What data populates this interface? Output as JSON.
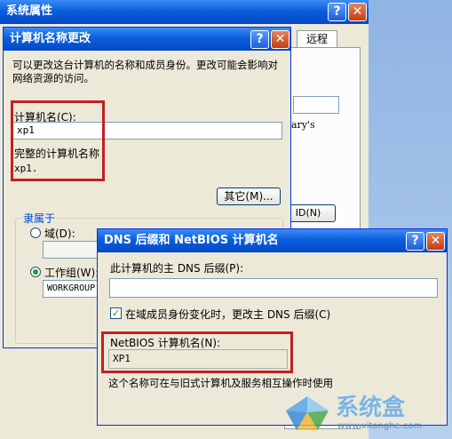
{
  "background_window": {
    "title": "系统属性",
    "tab_remote": "远程",
    "text_fragment": "ary's",
    "button_fragment": "ID(N)"
  },
  "rename_dialog": {
    "title": "计算机名称更改",
    "description": "可以更改这台计算机的名称和成员身份。更改可能会影响对网络资源的访问。",
    "computer_name_label": "计算机名(C):",
    "computer_name_value": "xp1",
    "full_name_label": "完整的计算机名称",
    "full_name_value": "xp1.",
    "more_button": "其它(M)...",
    "member_of_label": "隶属于",
    "domain_label": "域(D):",
    "domain_value": "",
    "workgroup_label": "工作组(W):",
    "workgroup_value": "WORKGROUP",
    "selected_membership": "workgroup"
  },
  "dns_dialog": {
    "title": "DNS 后缀和 NetBIOS 计算机名",
    "primary_dns_label": "此计算机的主 DNS 后缀(P):",
    "primary_dns_value": "",
    "change_suffix_label": "在域成员身份变化时，更改主 DNS 后缀(C)",
    "change_suffix_checked": true,
    "netbios_label": "NetBIOS 计算机名(N):",
    "netbios_value": "XP1",
    "note": "这个名称可在与旧式计算机及服务相互操作时使用"
  },
  "titlebar_buttons": {
    "help": "?",
    "close": "✕"
  },
  "watermark": {
    "brand": "系统盒",
    "url": "www.xitonghe.com"
  },
  "colors": {
    "highlight_box": "#c41f23",
    "titlebar": "#0a5fdc",
    "dialog_bg": "#ece9d8"
  }
}
